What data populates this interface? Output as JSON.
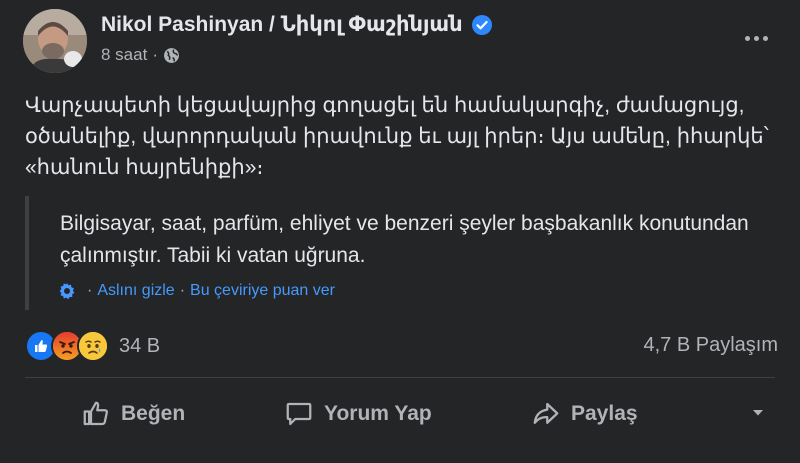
{
  "post": {
    "author": "Nikol Pashinyan / Նիկոլ Փաշինյան",
    "time": "8 saat",
    "separator": "·",
    "text": "Վարչապետի կեցավայրից գողացել են համակարգիչ, ժամացույց, օծանելիք, վարորդական իրավունք եւ այլ իրեր։ Այս ամենը, իհարկե՝ «հանուն հայրենիքի»։",
    "translation": {
      "text": "Bilgisayar, saat, parfüm, ehliyet ve benzeri şeyler başbakanlık konutundan çalınmıştır. Tabii ki vatan uğruna.",
      "dot1": "·",
      "hide_label": "Aslını gizle",
      "dot2": "·",
      "rate_label": "Bu çeviriye puan ver"
    },
    "reactions": {
      "types": [
        "like-icon",
        "angry-icon",
        "sad-icon"
      ],
      "count": "34 B"
    },
    "shares": "4,7 B Paylaşım"
  },
  "actions": {
    "like": "Beğen",
    "comment": "Yorum Yap",
    "share": "Paylaş"
  },
  "colors": {
    "background": "#242526",
    "text": "#e4e6eb",
    "secondary": "#b0b3b8",
    "link": "#4599ff",
    "verified": "#2d88ff"
  }
}
